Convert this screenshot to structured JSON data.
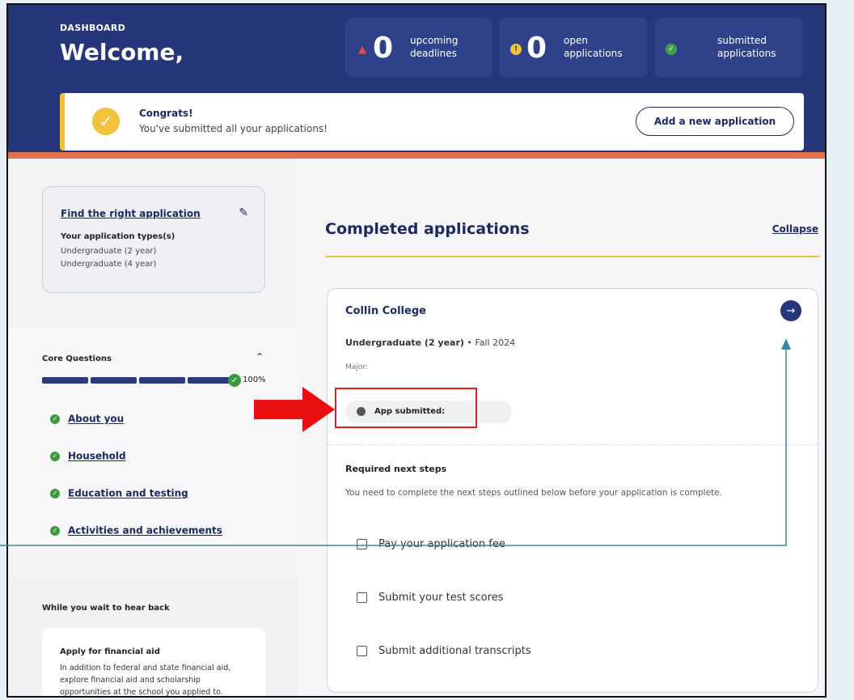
{
  "header": {
    "section_label": "DASHBOARD",
    "welcome": "Welcome,",
    "stats": [
      {
        "icon": "bell-icon",
        "count": "0",
        "label_line1": "upcoming",
        "label_line2": "deadlines",
        "color": "#e04848"
      },
      {
        "icon": "exclamation-icon",
        "count": "0",
        "label_line1": "open",
        "label_line2": "applications",
        "color": "#f1c232"
      },
      {
        "icon": "check-circle-icon",
        "count": "",
        "label_line1": "submitted",
        "label_line2": "applications",
        "color": "#43a047"
      }
    ]
  },
  "banner": {
    "title": "Congrats!",
    "message": "You've submitted all your applications!",
    "button": "Add a new application"
  },
  "sidebar": {
    "find_card": {
      "title": "Find the right application",
      "types_label": "Your application types(s)",
      "types": [
        "Undergraduate (2 year)",
        "Undergraduate (4 year)"
      ]
    },
    "core": {
      "title": "Core Questions",
      "progress": "100%",
      "items": [
        "About you",
        "Household",
        "Education and testing",
        "Activities and achievements"
      ]
    },
    "wait": {
      "title": "While you wait to hear back",
      "card_title": "Apply for financial aid",
      "card_text": "In addition to federal and state financial aid, explore financial aid and scholarship opportunities at the school you applied to."
    }
  },
  "main": {
    "title": "Completed applications",
    "collapse": "Collapse",
    "application": {
      "school": "Collin College",
      "program": "Undergraduate (2 year)",
      "term": " • Fall 2024",
      "major_label": "Major:",
      "status": "App submitted:",
      "required_title": "Required next steps",
      "required_desc": "You need to complete the next steps outlined below before your application is complete.",
      "steps": [
        "Pay your application fee",
        "Submit your test scores",
        "Submit additional transcripts"
      ]
    }
  }
}
